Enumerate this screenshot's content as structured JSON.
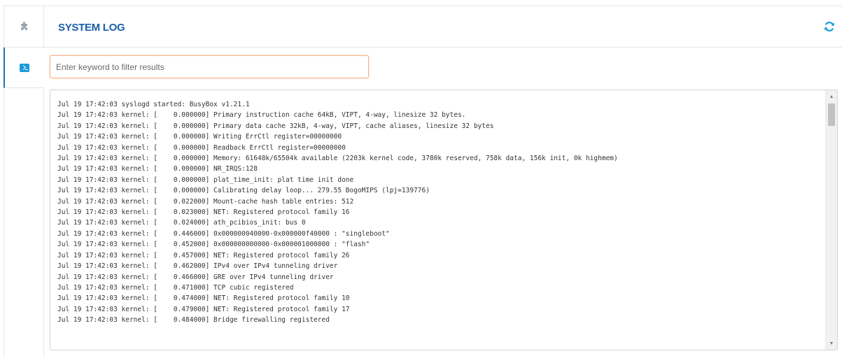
{
  "sidebar": {
    "tabs": [
      {
        "icon": "puzzle-icon"
      },
      {
        "icon": "terminal-icon"
      }
    ]
  },
  "header": {
    "title": "SYSTEM LOG",
    "refresh_icon": "refresh-icon"
  },
  "filter": {
    "placeholder": "Enter keyword to filter results",
    "value": ""
  },
  "log": {
    "lines": [
      "Jul 19 17:42:03 syslogd started: BusyBox v1.21.1",
      "Jul 19 17:42:03 kernel: [    0.000000] Primary instruction cache 64kB, VIPT, 4-way, linesize 32 bytes.",
      "Jul 19 17:42:03 kernel: [    0.000000] Primary data cache 32kB, 4-way, VIPT, cache aliases, linesize 32 bytes",
      "Jul 19 17:42:03 kernel: [    0.000000] Writing ErrCtl register=00000000",
      "Jul 19 17:42:03 kernel: [    0.000000] Readback ErrCtl register=00000000",
      "Jul 19 17:42:03 kernel: [    0.000000] Memory: 61648k/65504k available (2203k kernel code, 3780k reserved, 758k data, 156k init, 0k highmem)",
      "Jul 19 17:42:03 kernel: [    0.000000] NR_IRQS:128",
      "Jul 19 17:42:03 kernel: [    0.000000] plat_time_init: plat time init done",
      "Jul 19 17:42:03 kernel: [    0.000000] Calibrating delay loop... 279.55 BogoMIPS (lpj=139776)",
      "Jul 19 17:42:03 kernel: [    0.022000] Mount-cache hash table entries: 512",
      "Jul 19 17:42:03 kernel: [    0.023000] NET: Registered protocol family 16",
      "Jul 19 17:42:03 kernel: [    0.024000] ath_pcibios_init: bus 0",
      "Jul 19 17:42:03 kernel: [    0.446000] 0x000000040000-0x000000f40000 : \"singleboot\"",
      "Jul 19 17:42:03 kernel: [    0.452000] 0x000000000000-0x000001000000 : \"flash\"",
      "Jul 19 17:42:03 kernel: [    0.457000] NET: Registered protocol family 26",
      "Jul 19 17:42:03 kernel: [    0.462000] IPv4 over IPv4 tunneling driver",
      "Jul 19 17:42:03 kernel: [    0.466000] GRE over IPv4 tunneling driver",
      "Jul 19 17:42:03 kernel: [    0.471000] TCP cubic registered",
      "Jul 19 17:42:03 kernel: [    0.474000] NET: Registered protocol family 10",
      "Jul 19 17:42:03 kernel: [    0.479000] NET: Registered protocol family 17",
      "Jul 19 17:42:03 kernel: [    0.484000] Bridge firewalling registered"
    ]
  },
  "colors": {
    "title": "#1a5fa8",
    "accent": "#1a9bd7",
    "input_focus_border": "#f2b48a"
  }
}
